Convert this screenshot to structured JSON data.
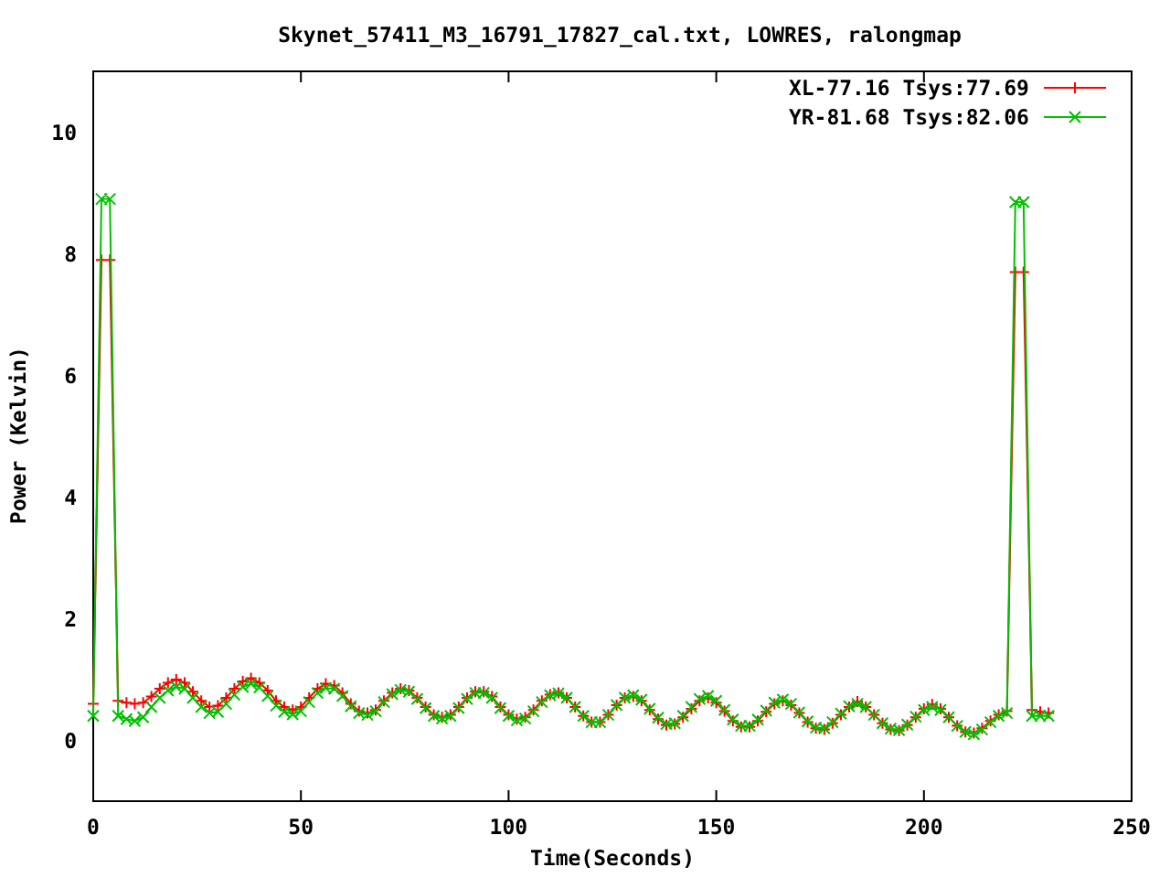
{
  "chart": {
    "chart_data": {
      "type": "line",
      "title": "Skynet_57411_M3_16791_17827_cal.txt, LOWRES, ralongmap",
      "xlabel": "Time(Seconds)",
      "ylabel": "Power (Kelvin)",
      "x": [
        0,
        2,
        4,
        6,
        8,
        10,
        12,
        14,
        16,
        18,
        20,
        22,
        24,
        26,
        28,
        30,
        32,
        34,
        36,
        38,
        40,
        42,
        44,
        46,
        48,
        50,
        52,
        54,
        56,
        58,
        60,
        62,
        64,
        66,
        68,
        70,
        72,
        74,
        76,
        78,
        80,
        82,
        84,
        86,
        88,
        90,
        92,
        94,
        96,
        98,
        100,
        102,
        104,
        106,
        108,
        110,
        112,
        114,
        116,
        118,
        120,
        122,
        124,
        126,
        128,
        130,
        132,
        134,
        136,
        138,
        140,
        142,
        144,
        146,
        148,
        150,
        152,
        154,
        156,
        158,
        160,
        162,
        164,
        166,
        168,
        170,
        172,
        174,
        176,
        178,
        180,
        182,
        184,
        186,
        188,
        190,
        192,
        194,
        196,
        198,
        200,
        202,
        204,
        206,
        208,
        210,
        212,
        214,
        216,
        218,
        220,
        222,
        224,
        226,
        228,
        230
      ],
      "series": [
        {
          "name": "XL-77.16 Tsys:77.69",
          "color": "#ff0000",
          "marker": "plus",
          "values": [
            0.6,
            7.9,
            7.9,
            0.65,
            0.62,
            0.6,
            0.62,
            0.72,
            0.85,
            0.95,
            1.0,
            0.95,
            0.8,
            0.65,
            0.55,
            0.57,
            0.7,
            0.85,
            0.97,
            1.02,
            0.95,
            0.82,
            0.65,
            0.55,
            0.5,
            0.55,
            0.7,
            0.85,
            0.93,
            0.9,
            0.78,
            0.6,
            0.48,
            0.45,
            0.5,
            0.65,
            0.78,
            0.85,
            0.82,
            0.7,
            0.55,
            0.42,
            0.38,
            0.42,
            0.55,
            0.7,
            0.8,
            0.8,
            0.72,
            0.55,
            0.42,
            0.35,
            0.38,
            0.5,
            0.65,
            0.75,
            0.78,
            0.7,
            0.55,
            0.4,
            0.3,
            0.3,
            0.42,
            0.58,
            0.7,
            0.72,
            0.65,
            0.5,
            0.35,
            0.25,
            0.27,
            0.38,
            0.52,
            0.65,
            0.7,
            0.62,
            0.48,
            0.32,
            0.22,
            0.22,
            0.32,
            0.47,
            0.6,
            0.65,
            0.58,
            0.45,
            0.3,
            0.2,
            0.18,
            0.28,
            0.42,
            0.55,
            0.64,
            0.55,
            0.42,
            0.28,
            0.18,
            0.16,
            0.25,
            0.38,
            0.52,
            0.59,
            0.52,
            0.38,
            0.24,
            0.14,
            0.12,
            0.2,
            0.32,
            0.42,
            0.48,
            7.7,
            7.7,
            0.5,
            0.47,
            0.45
          ]
        },
        {
          "name": "YR-81.68 Tsys:82.06",
          "color": "#00c000",
          "marker": "cross",
          "values": [
            0.4,
            8.9,
            8.9,
            0.4,
            0.35,
            0.32,
            0.38,
            0.55,
            0.7,
            0.82,
            0.88,
            0.85,
            0.7,
            0.55,
            0.45,
            0.47,
            0.6,
            0.75,
            0.88,
            0.93,
            0.87,
            0.73,
            0.57,
            0.47,
            0.43,
            0.48,
            0.63,
            0.78,
            0.86,
            0.85,
            0.73,
            0.56,
            0.45,
            0.42,
            0.48,
            0.63,
            0.76,
            0.83,
            0.8,
            0.68,
            0.53,
            0.4,
            0.36,
            0.4,
            0.53,
            0.68,
            0.78,
            0.78,
            0.7,
            0.53,
            0.4,
            0.33,
            0.36,
            0.48,
            0.63,
            0.74,
            0.77,
            0.7,
            0.55,
            0.4,
            0.3,
            0.3,
            0.42,
            0.58,
            0.7,
            0.74,
            0.67,
            0.52,
            0.37,
            0.27,
            0.28,
            0.4,
            0.55,
            0.68,
            0.73,
            0.65,
            0.5,
            0.34,
            0.24,
            0.24,
            0.34,
            0.49,
            0.62,
            0.67,
            0.6,
            0.46,
            0.31,
            0.21,
            0.2,
            0.3,
            0.44,
            0.56,
            0.6,
            0.55,
            0.42,
            0.28,
            0.19,
            0.17,
            0.26,
            0.39,
            0.5,
            0.55,
            0.5,
            0.38,
            0.24,
            0.14,
            0.1,
            0.18,
            0.3,
            0.4,
            0.45,
            8.85,
            8.85,
            0.4,
            0.4,
            0.4
          ]
        }
      ],
      "legend": true,
      "xlim": [
        0,
        250
      ],
      "ylim": [
        -1,
        11
      ],
      "xticks": [
        0,
        50,
        100,
        150,
        200,
        250
      ],
      "yticks": [
        0,
        2,
        4,
        6,
        8,
        10
      ]
    }
  }
}
